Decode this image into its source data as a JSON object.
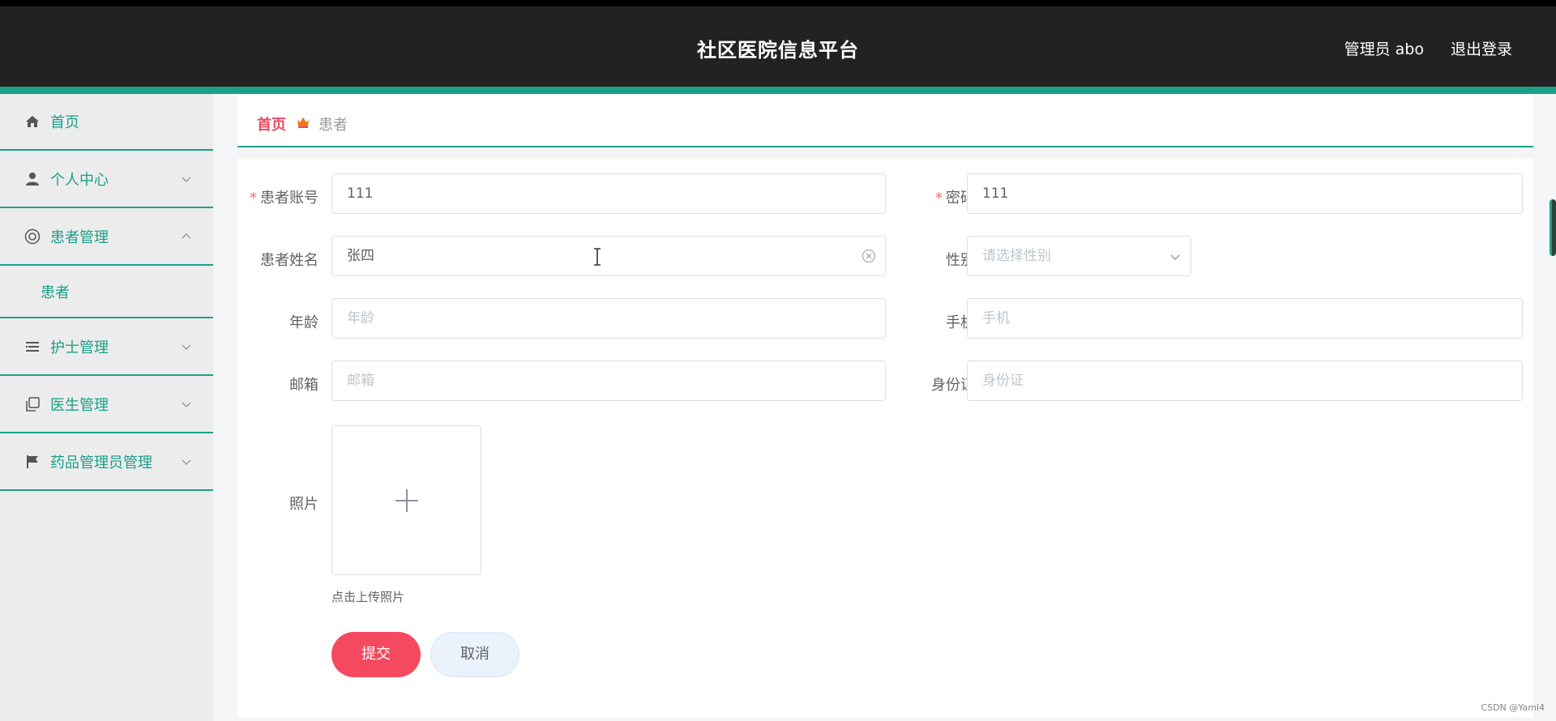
{
  "header": {
    "title": "社区医院信息平台",
    "user_text": "管理员 abo",
    "logout_label": "退出登录"
  },
  "sidebar": {
    "items": [
      {
        "label": "首页",
        "icon": "home-icon"
      },
      {
        "label": "个人中心",
        "icon": "user-icon",
        "expanded": false
      },
      {
        "label": "患者管理",
        "icon": "patient-manage-icon",
        "expanded": true,
        "children": [
          {
            "label": "患者"
          }
        ]
      },
      {
        "label": "护士管理",
        "icon": "list-icon",
        "expanded": false
      },
      {
        "label": "医生管理",
        "icon": "copy-icon",
        "expanded": false
      },
      {
        "label": "药品管理员管理",
        "icon": "flag-icon",
        "expanded": false
      }
    ]
  },
  "breadcrumb": {
    "home": "首页",
    "separator_icon": "crown-icon",
    "current": "患者"
  },
  "form": {
    "account": {
      "label": "患者账号",
      "required": true,
      "value": "111"
    },
    "password": {
      "label": "密码",
      "required": true,
      "value": "111"
    },
    "name": {
      "label": "患者姓名",
      "value": "张四"
    },
    "gender": {
      "label": "性别",
      "placeholder": "请选择性别"
    },
    "age": {
      "label": "年龄",
      "placeholder": "年龄"
    },
    "phone": {
      "label": "手机",
      "placeholder": "手机"
    },
    "email": {
      "label": "邮箱",
      "placeholder": "邮箱"
    },
    "idcard": {
      "label": "身份证",
      "placeholder": "身份证"
    },
    "photo": {
      "label": "照片",
      "hint": "点击上传照片"
    },
    "submit_label": "提交",
    "cancel_label": "取消"
  },
  "colors": {
    "accent": "#1aa08a",
    "header_bg": "#222222",
    "submit": "#f4495f",
    "breadcrumb_home": "#e84a5f"
  },
  "watermark": "CSDN @Yaml4"
}
